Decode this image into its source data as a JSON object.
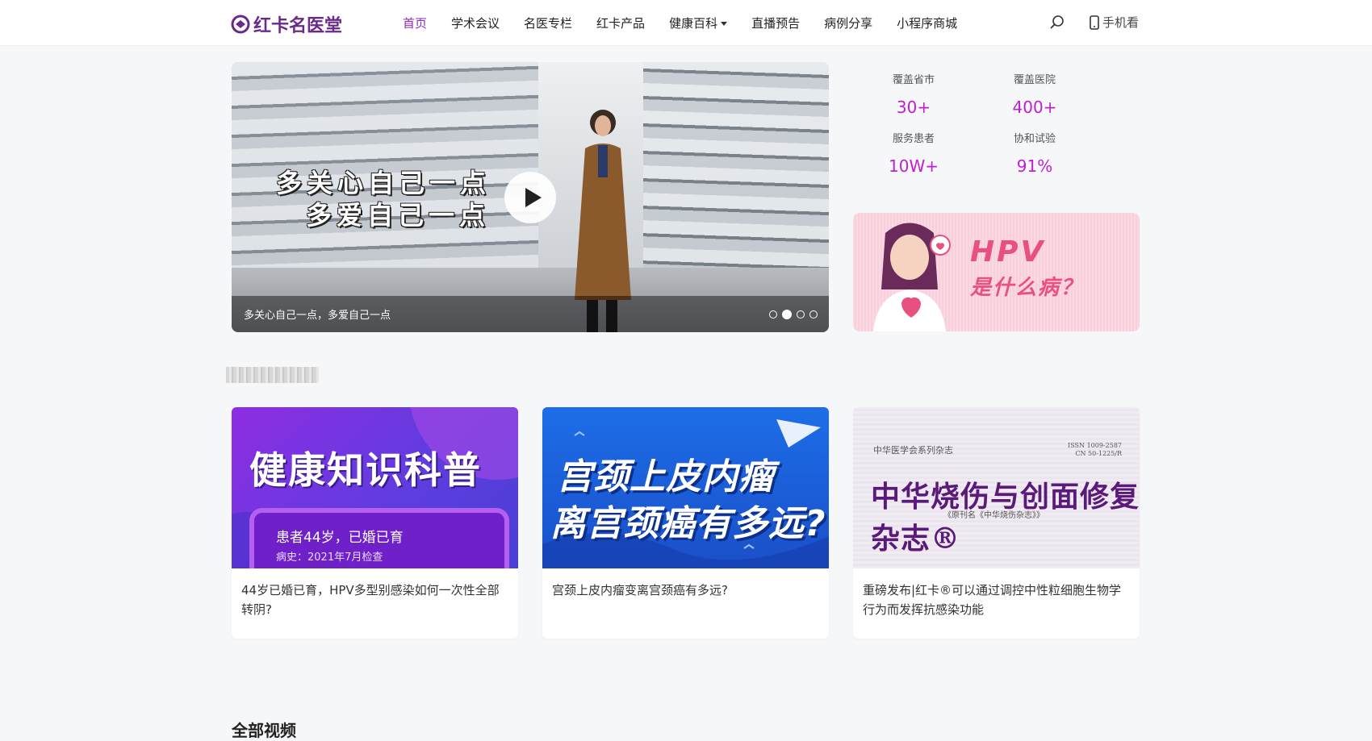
{
  "header": {
    "logo_text": "红卡名医堂",
    "nav": [
      "首页",
      "学术会议",
      "名医专栏",
      "红卡产品",
      "健康百科",
      "直播预告",
      "病例分享",
      "小程序商城"
    ],
    "mobile_label": "手机看"
  },
  "hero": {
    "overlay_line1": "多关心自己一点",
    "overlay_line2": "多爱自己一点",
    "caption": "多关心自己一点，多爱自己一点",
    "slide_count": 4,
    "active_slide": 2
  },
  "stats": [
    {
      "label": "覆盖省市",
      "value": "30+"
    },
    {
      "label": "覆盖医院",
      "value": "400+"
    },
    {
      "label": "服务患者",
      "value": "10W+"
    },
    {
      "label": "协和试验",
      "value": "91%"
    }
  ],
  "banner": {
    "title": "HPV",
    "subtitle": "是什么病？"
  },
  "cards": [
    {
      "img_title": "健康知识科普",
      "img_line1": "患者44岁，已婚已育",
      "img_line2": "病史：2021年7月检查",
      "title": "44岁已婚已育，HPV多型别感染如何一次性全部转阴?"
    },
    {
      "img_line1": "宫颈上皮内瘤",
      "img_line2": "离宫颈癌有多远?",
      "title": "宫颈上皮内瘤变离宫颈癌有多远?"
    },
    {
      "img_small": "中华医学会系列杂志",
      "img_issn1": "ISSN 1009-2587",
      "img_issn2": "CN 50-1225/R",
      "img_big": "中华烧伤与创面修复杂志®",
      "img_orig": "《原刊名《中华烧伤杂志》》",
      "title": "重磅发布|红卡®可以通过调控中性粒细胞生物学行为而发挥抗感染功能"
    }
  ],
  "section": {
    "title": "全部视频"
  },
  "colors": {
    "brand": "#6a2a8c",
    "nav_active": "#8a2bb5",
    "stat_value": "#c01fd1",
    "hpv_pink": "#e8517f"
  }
}
